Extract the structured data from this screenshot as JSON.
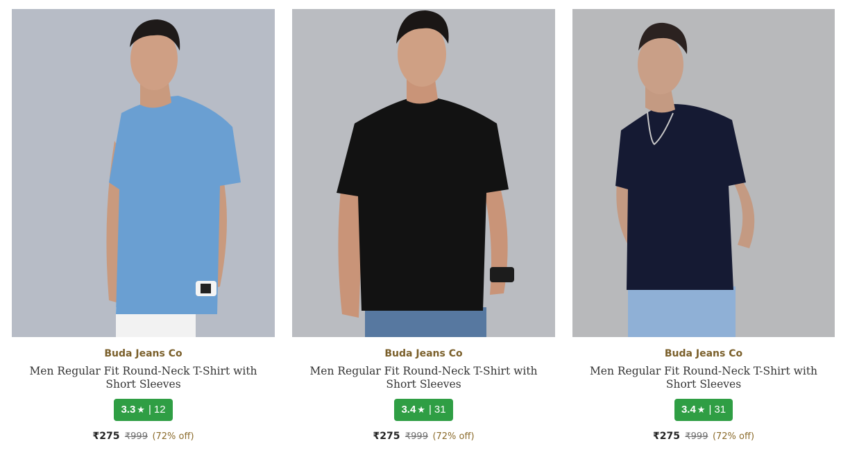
{
  "products": [
    {
      "brand": "Buda Jeans Co",
      "title": "Men Regular Fit Round-Neck T-Shirt with Short Sleeves",
      "rating": "3.3",
      "star": "★",
      "separator": "|",
      "reviews": "12",
      "price": "₹275",
      "mrp": "₹999",
      "discount": "(72% off)",
      "shirt_color": "#6a9fd2",
      "image_alt": "blue-tshirt-model"
    },
    {
      "brand": "Buda Jeans Co",
      "title": "Men Regular Fit Round-Neck T-Shirt with Short Sleeves",
      "rating": "3.4",
      "star": "★",
      "separator": "|",
      "reviews": "31",
      "price": "₹275",
      "mrp": "₹999",
      "discount": "(72% off)",
      "shirt_color": "#121212",
      "image_alt": "black-tshirt-model"
    },
    {
      "brand": "Buda Jeans Co",
      "title": "Men Regular Fit Round-Neck T-Shirt with Short Sleeves",
      "rating": "3.4",
      "star": "★",
      "separator": "|",
      "reviews": "31",
      "price": "₹275",
      "mrp": "₹999",
      "discount": "(72% off)",
      "shirt_color": "#151a33",
      "image_alt": "navy-tshirt-model"
    }
  ],
  "colors": {
    "brand_text": "#7a5f2a",
    "rating_badge": "#2f9e44",
    "photo_background": "#b9bcc2"
  }
}
